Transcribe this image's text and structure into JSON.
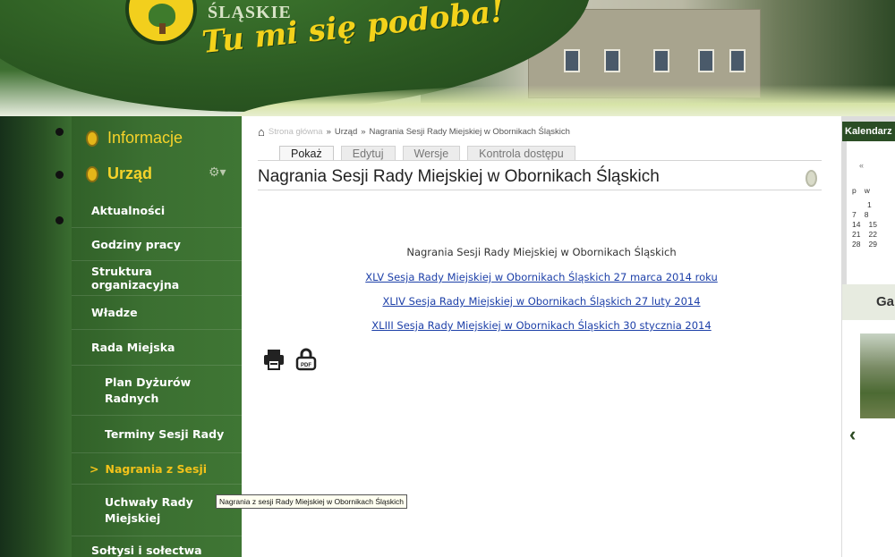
{
  "header": {
    "region_name": "ŚLĄSKIE",
    "slogan": "Tu mi się podoba!"
  },
  "sidebar": {
    "headings": [
      {
        "label": "Informacje"
      },
      {
        "label": "Urząd"
      }
    ],
    "items": [
      {
        "label": "Aktualności"
      },
      {
        "label": "Godziny pracy"
      },
      {
        "label": "Struktura organizacyjna"
      },
      {
        "label": "Władze"
      },
      {
        "label": "Rada Miejska"
      },
      {
        "label": "Plan Dyżurów Radnych"
      },
      {
        "label": "Terminy Sesji Rady"
      },
      {
        "label": "Nagrania z Sesji"
      },
      {
        "label": "Uchwały Rady Miejskiej"
      },
      {
        "label": "Sołtysi i sołectwa"
      }
    ],
    "active_marker": ">"
  },
  "breadcrumb": {
    "home": "Strona główna",
    "sep": "»",
    "items": [
      "Urząd",
      "Nagrania Sesji Rady Miejskiej w Obornikach Śląskich"
    ]
  },
  "tabs": [
    {
      "label": "Pokaż",
      "active": true
    },
    {
      "label": "Edytuj"
    },
    {
      "label": "Wersje"
    },
    {
      "label": "Kontrola dostępu"
    }
  ],
  "main": {
    "title": "Nagrania Sesji Rady Miejskiej w Obornikach Śląskich",
    "article_heading": "Nagrania Sesji Rady Miejskiej w Obornikach Śląskich",
    "links": [
      "XLV Sesja Rady Miejskiej w Obornikach Śląskich 27 marca 2014 roku",
      "XLIV Sesja Rady Miejskiej w Obornikach Śląskich 27 luty 2014",
      "XLIII Sesja Rady Miejskiej w Obornikach Śląskich 30 stycznia 2014"
    ],
    "pdf_label": "PDF"
  },
  "tooltip": "Nagrania z sesji Rady Miejskiej w Obornikach Śląskich",
  "calendar": {
    "title": "Kalendarz",
    "prev": "«",
    "weekdays": [
      "p",
      "w"
    ],
    "rows": [
      [
        "",
        "1"
      ],
      [
        "7",
        "8"
      ],
      [
        "14",
        "15"
      ],
      [
        "21",
        "22"
      ],
      [
        "28",
        "29"
      ]
    ]
  },
  "gallery": {
    "title": "Galeria",
    "prev": "‹"
  }
}
